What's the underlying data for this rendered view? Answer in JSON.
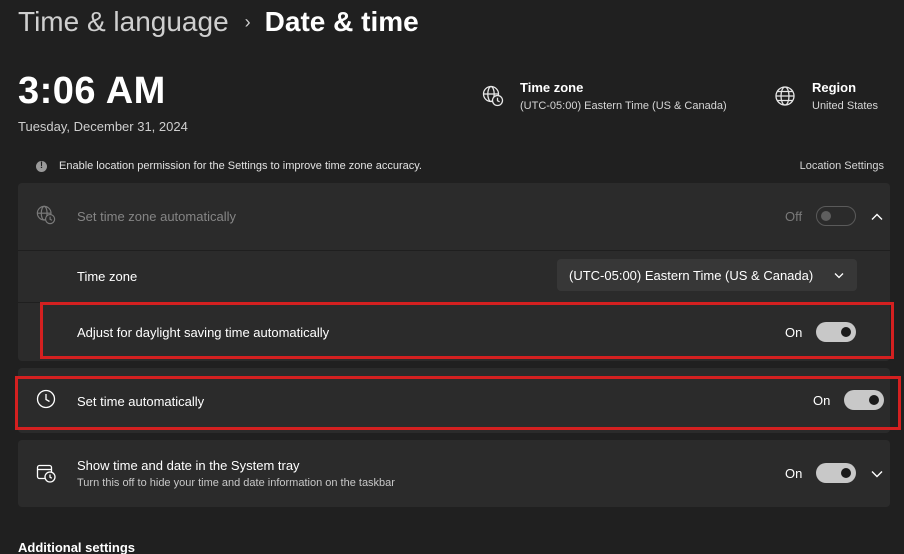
{
  "breadcrumb": {
    "parent": "Time & language",
    "separator": "›",
    "current": "Date & time"
  },
  "clock": {
    "time": "3:06 AM",
    "date": "Tuesday, December 31, 2024"
  },
  "timezone_info": {
    "title": "Time zone",
    "value": "(UTC-05:00) Eastern Time (US & Canada)",
    "icon": "globe-clock-icon"
  },
  "region_info": {
    "title": "Region",
    "value": "United States",
    "icon": "globe-icon"
  },
  "notice": {
    "text": "Enable location permission for the Settings to improve time zone accuracy.",
    "link": "Location Settings"
  },
  "settings": {
    "auto_timezone": {
      "label": "Set time zone automatically",
      "state": "Off",
      "enabled": false
    },
    "timezone": {
      "label": "Time zone",
      "selected": "(UTC-05:00) Eastern Time (US & Canada)"
    },
    "daylight": {
      "label": "Adjust for daylight saving time automatically",
      "state": "On"
    },
    "auto_time": {
      "label": "Set time automatically",
      "state": "On"
    },
    "systray": {
      "label": "Show time and date in the System tray",
      "description": "Turn this off to hide your time and date information on the taskbar",
      "state": "On"
    }
  },
  "additional_settings": "Additional settings",
  "colors": {
    "background": "#202020",
    "card": "#2b2b2b",
    "highlight": "#d42020",
    "toggle_on": "#c8c8c8"
  }
}
